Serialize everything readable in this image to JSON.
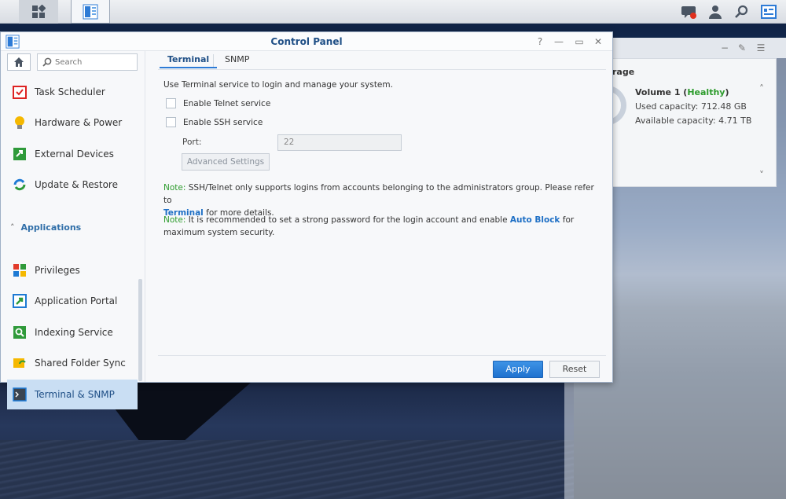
{
  "window": {
    "title": "Control Panel"
  },
  "sidebar": {
    "search_placeholder": "Search",
    "section_label": "Applications",
    "items": [
      {
        "label": "Task Scheduler"
      },
      {
        "label": "Hardware & Power"
      },
      {
        "label": "External Devices"
      },
      {
        "label": "Update & Restore"
      },
      {
        "label": "Privileges"
      },
      {
        "label": "Application Portal"
      },
      {
        "label": "Indexing Service"
      },
      {
        "label": "Shared Folder Sync"
      },
      {
        "label": "Terminal & SNMP"
      }
    ]
  },
  "tabs": [
    {
      "label": "Terminal"
    },
    {
      "label": "SNMP"
    }
  ],
  "terminal": {
    "description": "Use Terminal service to login and manage your system.",
    "telnet_label": "Enable Telnet service",
    "ssh_label": "Enable SSH service",
    "port_label": "Port:",
    "port_value": "22",
    "advanced_label": "Advanced Settings",
    "note1_key": "Note:",
    "note1_text": "SSH/Telnet only supports logins from accounts belonging to the administrators group. Please refer to",
    "note1_link": "Terminal",
    "note1_tail": "for more details.",
    "note2_key": "Note:",
    "note2_text": "It is recommended to set a strong password for the login account and enable",
    "note2_link": "Auto Block",
    "note2_tail": "for maximum system security."
  },
  "footer": {
    "apply_label": "Apply",
    "reset_label": "Reset"
  },
  "widget": {
    "title": "rage",
    "volume_name": "Volume 1 (",
    "volume_status": "Healthy",
    "volume_close": ")",
    "used": "Used capacity: 712.48 GB",
    "available": "Available capacity: 4.71 TB"
  },
  "colors": {
    "accent": "#1f72cf",
    "healthy": "#2c9b2c",
    "link": "#1e6fc5"
  }
}
